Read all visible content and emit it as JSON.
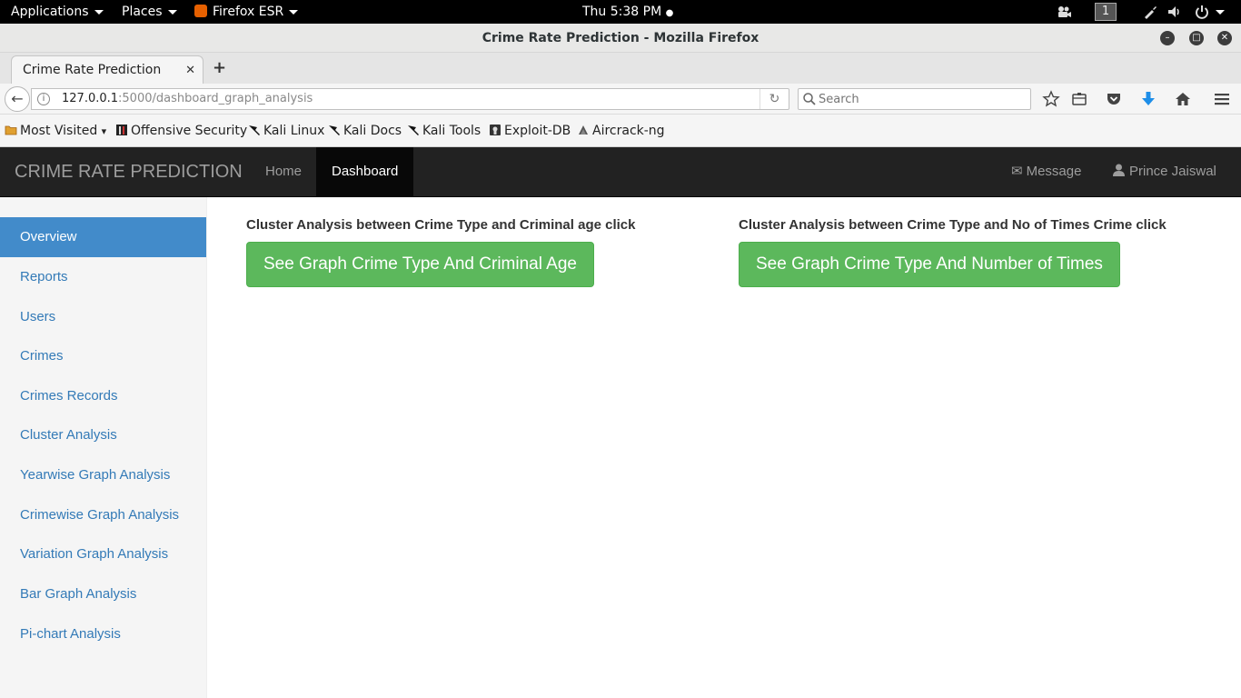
{
  "gnome_bar": {
    "applications": "Applications",
    "places": "Places",
    "browser_app": "Firefox ESR",
    "clock": "Thu  5:38 PM",
    "workspace": "1"
  },
  "window": {
    "title": "Crime Rate Prediction - Mozilla Firefox"
  },
  "tabs": [
    {
      "title": "Crime Rate Prediction",
      "close": "✕"
    }
  ],
  "new_tab": "+",
  "url_bar": {
    "host": "127.0.0.1",
    "rest": ":5000/dashboard_graph_analysis"
  },
  "search": {
    "placeholder": "Search"
  },
  "bookmarks": [
    {
      "label": "Most Visited",
      "icon": "folder-icon"
    },
    {
      "label": "Offensive Security",
      "icon": "offsec-icon"
    },
    {
      "label": "Kali Linux",
      "icon": "kali-dragon-icon"
    },
    {
      "label": "Kali Docs",
      "icon": "kali-dragon-icon"
    },
    {
      "label": "Kali Tools",
      "icon": "kali-dragon-icon"
    },
    {
      "label": "Exploit-DB",
      "icon": "exploitdb-icon"
    },
    {
      "label": "Aircrack-ng",
      "icon": "aircrack-icon"
    }
  ],
  "app_nav": {
    "brand": "CRIME RATE PREDICTION",
    "links": [
      "Home",
      "Dashboard"
    ],
    "message": "Message",
    "user": "Prince Jaiswal"
  },
  "sidebar": {
    "items": [
      "Overview",
      "Reports",
      "Users",
      "Crimes",
      "Crimes Records",
      "Cluster Analysis",
      "Yearwise Graph Analysis",
      "Crimewise Graph Analysis",
      "Variation Graph Analysis",
      "Bar Graph Analysis",
      "Pi-chart Analysis"
    ]
  },
  "main": {
    "left": {
      "label": "Cluster Analysis between Crime Type and Criminal age click",
      "button": "See Graph Crime Type And Criminal Age"
    },
    "right": {
      "label": "Cluster Analysis between Crime Type and No of Times Crime click",
      "button": "See Graph Crime Type And Number of Times"
    }
  },
  "colors": {
    "navbar_bg": "#222222",
    "sidebar_active": "#428bca",
    "link": "#337ab7",
    "success_button": "#5cb85c"
  }
}
